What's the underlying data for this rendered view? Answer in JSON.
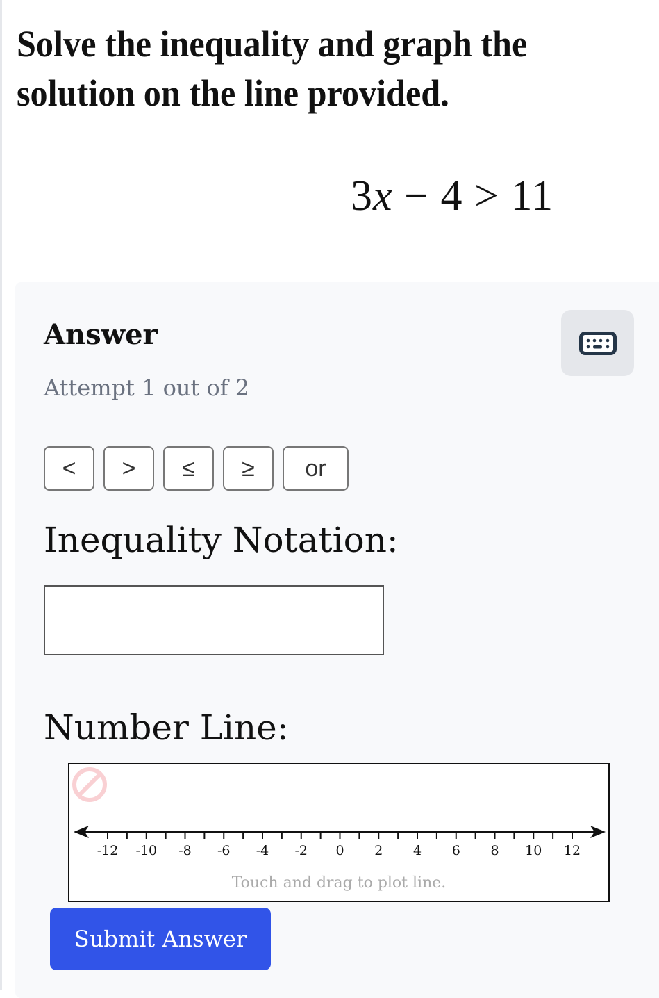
{
  "question": {
    "prompt": "Solve the inequality and graph the solution on the line provided.",
    "equation": {
      "coefficient": "3",
      "variable": "x",
      "rest": " − 4 > 11"
    }
  },
  "answer": {
    "title": "Answer",
    "attempt": "Attempt 1 out of 2",
    "keyboard_icon": "keyboard-icon",
    "symbol_buttons": [
      {
        "label": "<",
        "name": "less-than"
      },
      {
        "label": ">",
        "name": "greater-than"
      },
      {
        "label": "≤",
        "name": "less-than-or-equal"
      },
      {
        "label": "≥",
        "name": "greater-than-or-equal"
      },
      {
        "label": "or",
        "name": "or"
      }
    ],
    "inequality_label": "Inequality Notation:",
    "inequality_value": "",
    "number_line_label": "Number Line:",
    "number_line": {
      "min": -12,
      "max": 12,
      "tick_step": 1,
      "label_step": 2,
      "labels": [
        "-12",
        "-10",
        "-8",
        "-6",
        "-4",
        "-2",
        "0",
        "2",
        "4",
        "6",
        "8",
        "10",
        "12"
      ],
      "hint": "Touch and drag to plot line.",
      "clear_icon": "no-entry-icon",
      "clear_icon_color": "#f9d0d3"
    },
    "submit_label": "Submit Answer",
    "submit_color": "#3154e8"
  }
}
